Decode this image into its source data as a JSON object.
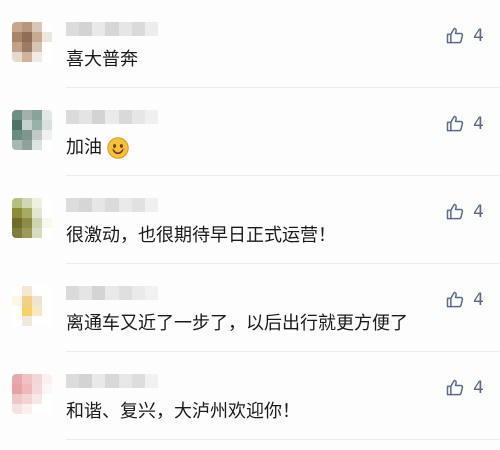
{
  "comments": [
    {
      "text": "喜大普奔",
      "likes": "4",
      "emoji": null,
      "avatar_colors": [
        "#c7a58f",
        "#b8967c",
        "#d8c7b7",
        "#ffffff",
        "#a6866b",
        "#8f6d56",
        "#c9a98f",
        "#eee7df",
        "#c2a188",
        "#9c7b66",
        "#d7c4b1",
        "#ffffff",
        "#e7d9cb",
        "#cfb39a",
        "#f3ece6",
        "#ffffff"
      ],
      "name_colors": [
        "#d9d9d9",
        "#cfcfcf",
        "#e7e7e7",
        "#d2d2d2",
        "#e4e4e4",
        "#d7d7d7",
        "#ececec"
      ]
    },
    {
      "text": "加油",
      "likes": "4",
      "emoji": "smile-emoji",
      "avatar_colors": [
        "#6e8f84",
        "#a4b1aa",
        "#88a39b",
        "#e3e7e5",
        "#4f7266",
        "#c6cfcc",
        "#9ab1a8",
        "#d9e1de",
        "#6b8c80",
        "#7e968d",
        "#bfc9c5",
        "#eef1f0",
        "#a9b8b2",
        "#8ea39b",
        "#dde4e1",
        "#ffffff"
      ],
      "name_colors": [
        "#d8d8d8",
        "#e2e2e2",
        "#cfcfcf",
        "#e9e9e9",
        "#d6d6d6",
        "#e4e4e4",
        "#efefef"
      ]
    },
    {
      "text": "很激动，也很期待早日正式运营！",
      "likes": "4",
      "emoji": null,
      "avatar_colors": [
        "#b6c07e",
        "#d1d7b2",
        "#eef1e0",
        "#ffffff",
        "#8c8c34",
        "#a7aa5f",
        "#e4e7cf",
        "#ffffff",
        "#6f6d2b",
        "#8e8b44",
        "#cfd3ae",
        "#f7f8f0",
        "#7f7d3d",
        "#9b9a5a",
        "#d9dcc0",
        "#ffffff"
      ],
      "name_colors": [
        "#dadada",
        "#d2d2d2",
        "#e4e4e4",
        "#d8d8d8",
        "#e8e8e8",
        "#dfdfdf",
        "#efefef"
      ]
    },
    {
      "text": "离通车又近了一步了，以后出行就更方便了",
      "likes": "4",
      "emoji": null,
      "avatar_colors": [
        "#ffffff",
        "#f4e8d2",
        "#ffffff",
        "#ffffff",
        "#fff7e5",
        "#f1d087",
        "#efe4cd",
        "#ffffff",
        "#ffffff",
        "#f5d36a",
        "#f8e9c2",
        "#ffffff",
        "#ffffff",
        "#f1e9dc",
        "#ffffff",
        "#ffffff"
      ],
      "name_colors": [
        "#d7d7d7",
        "#e3e3e3",
        "#d0d0d0",
        "#e7e7e7",
        "#dcdcdc",
        "#e9e9e9",
        "#f0f0f0"
      ]
    },
    {
      "text": "和谐、复兴，大泸州欢迎你！",
      "likes": "4",
      "emoji": null,
      "avatar_colors": [
        "#e8a9ae",
        "#f0c2c4",
        "#f3d7d7",
        "#fbf0f0",
        "#e7a2a6",
        "#efb9bb",
        "#f5d9da",
        "#fff7f7",
        "#efc7c9",
        "#f4d3d4",
        "#f8e7e7",
        "#ffffff",
        "#f7e2e3",
        "#fbeff0",
        "#ffffff",
        "#ffffff"
      ],
      "name_colors": [
        "#d9d9d9",
        "#cfcfcf",
        "#e7e7e7",
        "#d5d5d5",
        "#e5e5e5",
        "#dadada",
        "#f0f0f0"
      ]
    }
  ]
}
